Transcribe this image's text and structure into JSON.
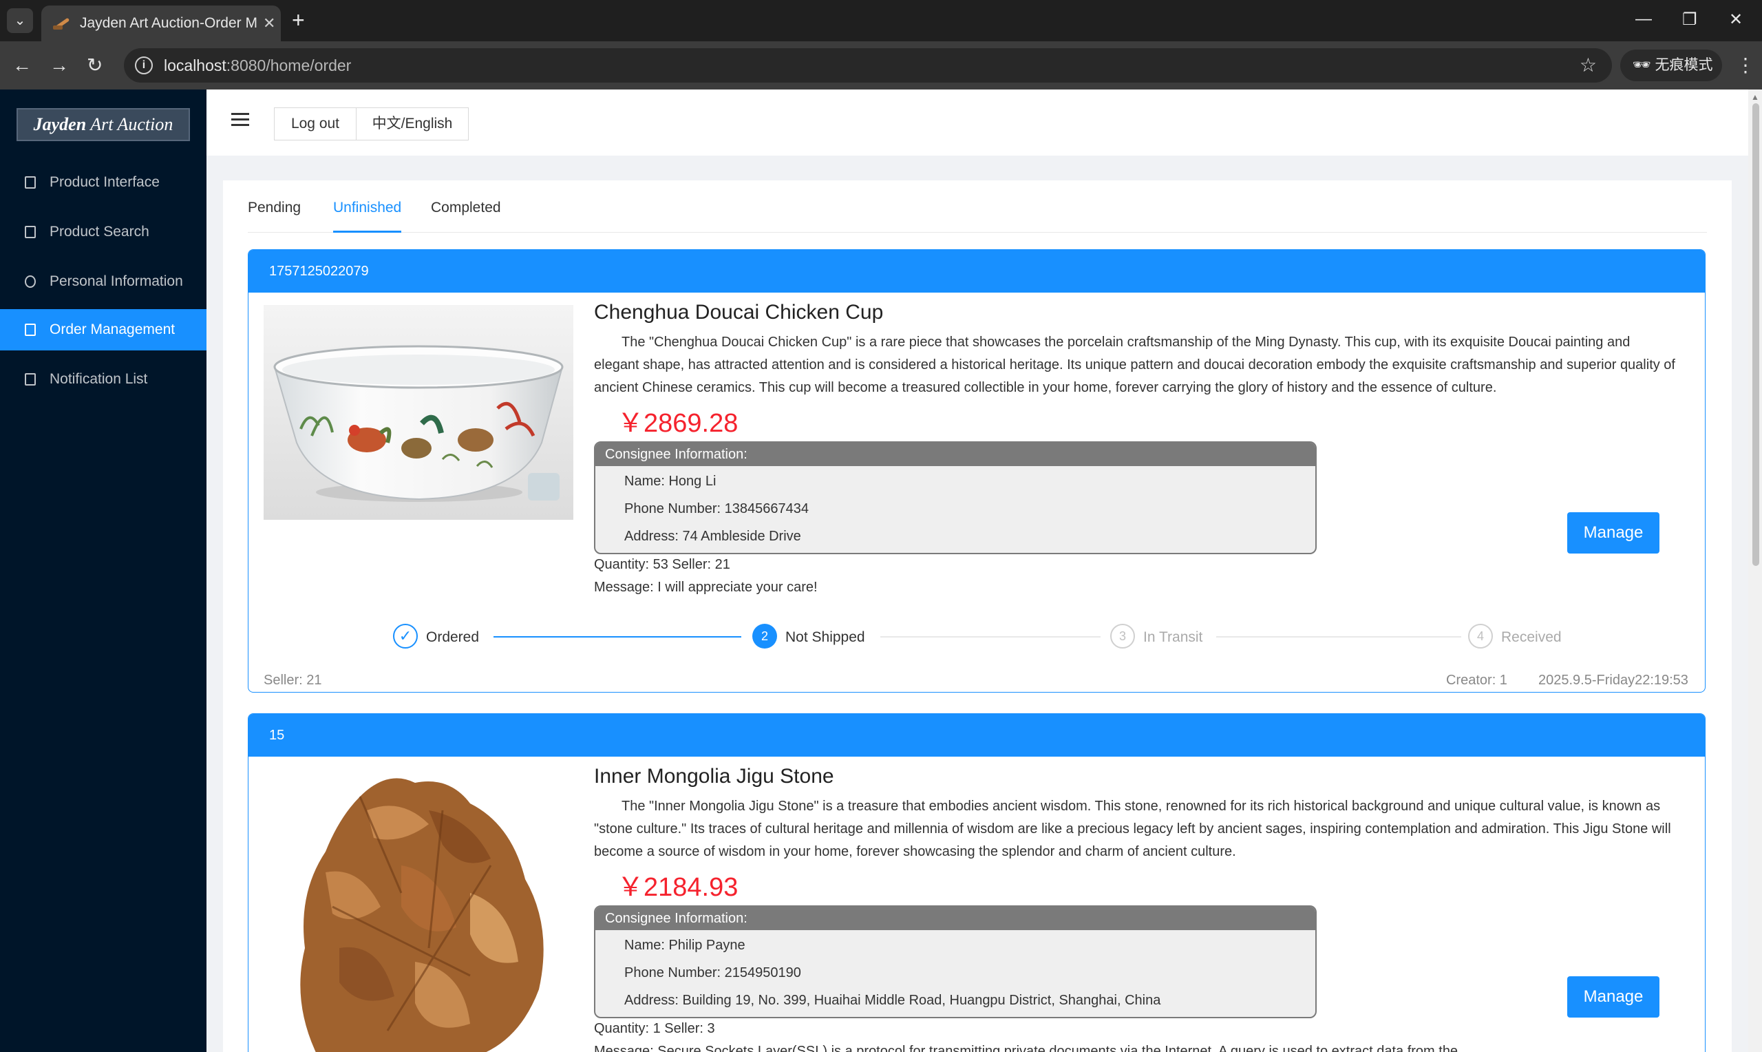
{
  "browser": {
    "tab_title": "Jayden Art Auction-Order Management",
    "url_host": "localhost",
    "url_rest": ":8080/home/order",
    "incognito_label": "无痕模式",
    "window_controls": [
      "minimize-icon",
      "restore-icon",
      "close-icon"
    ]
  },
  "sidebar": {
    "logo_bold": "Jayden",
    "logo_rest": " Art Auction",
    "items": [
      {
        "label": "Product Interface",
        "icon": "shopping-bag-icon"
      },
      {
        "label": "Product Search",
        "icon": "search-doc-icon"
      },
      {
        "label": "Personal Information",
        "icon": "user-icon"
      },
      {
        "label": "Order Management",
        "icon": "order-icon",
        "active": true
      },
      {
        "label": "Notification List",
        "icon": "notification-icon"
      }
    ]
  },
  "header": {
    "logout_label": "Log out",
    "lang_label": "中文/English"
  },
  "tabs": [
    {
      "label": "Pending"
    },
    {
      "label": "Unfinished",
      "active": true
    },
    {
      "label": "Completed"
    }
  ],
  "orders": [
    {
      "id": "1757125022079",
      "name": "Chenghua Doucai Chicken Cup",
      "description": "The \"Chenghua Doucai Chicken Cup\" is a rare piece that showcases the porcelain craftsmanship of the Ming Dynasty. This cup, with its exquisite Doucai painting and elegant shape, has attracted attention and is considered a historical heritage. Its unique pattern and doucai decoration embody the exquisite craftsmanship and superior quality of ancient Chinese ceramics. This cup will become a treasured collectible in your home, forever carrying the glory of history and the essence of culture.",
      "price": "￥2869.28",
      "consignee_header": "Consignee Information:",
      "consignee_name": "Name: Hong Li",
      "consignee_phone": "Phone Number: 13845667434",
      "consignee_address": "Address: 74 Ambleside Drive",
      "quantity_seller": "Quantity: 53 Seller: 21",
      "message": "Message: I will appreciate your care!",
      "manage_label": "Manage",
      "steps": [
        {
          "label": "Ordered",
          "status": "done",
          "marker": "✓"
        },
        {
          "label": "Not Shipped",
          "status": "current",
          "marker": "2"
        },
        {
          "label": "In Transit",
          "status": "wait",
          "marker": "3"
        },
        {
          "label": "Received",
          "status": "wait",
          "marker": "4"
        }
      ],
      "footer_seller": "Seller: 21",
      "footer_creator": "Creator: 1",
      "footer_time": "2025.9.5-Friday22:19:53"
    },
    {
      "id": "15",
      "name": "Inner Mongolia Jigu Stone",
      "description": "The \"Inner Mongolia Jigu Stone\" is a treasure that embodies ancient wisdom. This stone, renowned for its rich historical background and unique cultural value, is known as \"stone culture.\" Its traces of cultural heritage and millennia of wisdom are like a precious legacy left by ancient sages, inspiring contemplation and admiration. This Jigu Stone will become a source of wisdom in your home, forever showcasing the splendor and charm of ancient culture.",
      "price": "￥2184.93",
      "consignee_header": "Consignee Information:",
      "consignee_name": "Name: Philip Payne",
      "consignee_phone": "Phone Number: 2154950190",
      "consignee_address": "Address: Building 19, No. 399, Huaihai Middle Road, Huangpu District, Shanghai, China",
      "quantity_seller": "Quantity: 1 Seller: 3",
      "message": "Message: Secure Sockets Layer(SSL) is a protocol for transmitting private documents via the Internet. A query is used to extract data from the",
      "manage_label": "Manage"
    }
  ]
}
